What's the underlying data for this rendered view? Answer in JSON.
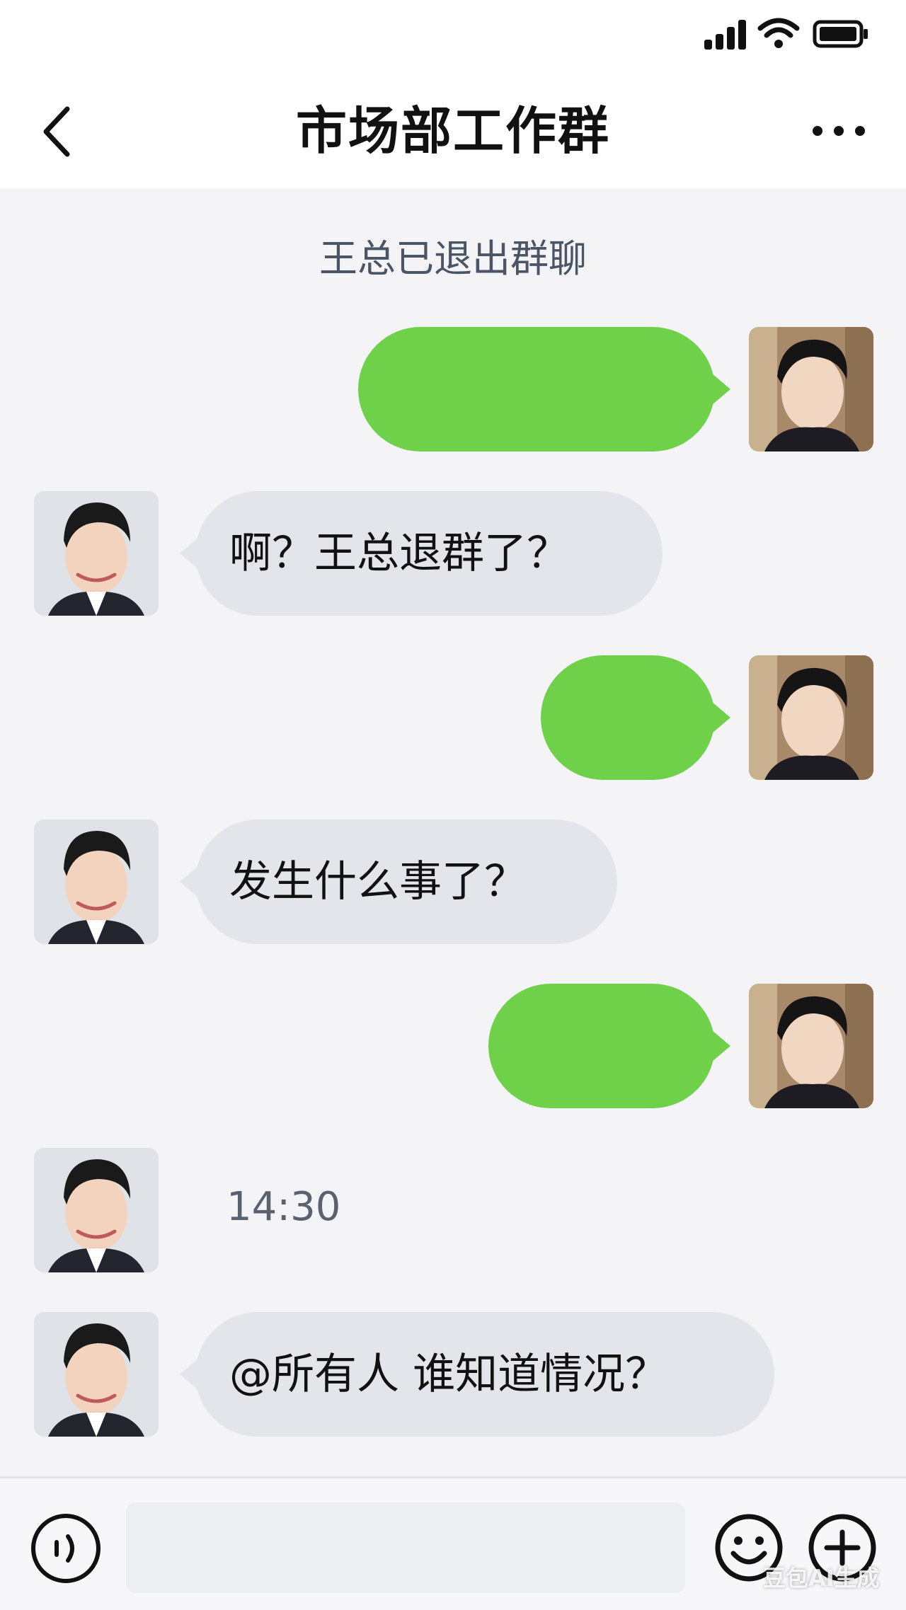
{
  "status_bar": {
    "icons": [
      "signal-icon",
      "wifi-icon",
      "battery-icon"
    ]
  },
  "header": {
    "back_icon": "chevron-left-icon",
    "title": "市场部工作群",
    "more_icon": "ellipsis-icon"
  },
  "chat": {
    "system_message": "王总已退出群聊",
    "messages": [
      {
        "side": "right",
        "text": "",
        "avatar": "avatar-self"
      },
      {
        "side": "left",
        "text": "啊？王总退群了？",
        "avatar": "avatar-colleague"
      },
      {
        "side": "right",
        "text": "",
        "avatar": "avatar-self"
      },
      {
        "side": "left",
        "text": "发生什么事了？",
        "avatar": "avatar-colleague"
      },
      {
        "side": "right",
        "text": "",
        "avatar": "avatar-self"
      },
      {
        "side": "left",
        "text": "",
        "avatar": "avatar-colleague"
      },
      {
        "side": "left",
        "text": "@所有人 谁知道情况？",
        "avatar": "avatar-colleague"
      }
    ],
    "time_label": "14:30"
  },
  "input_bar": {
    "voice_icon": "voice-icon",
    "input_value": "",
    "emoji_icon": "emoji-icon",
    "plus_icon": "plus-icon"
  },
  "watermark": "豆包AI生成",
  "colors": {
    "sent_bubble": "#6fd04a",
    "received_bubble": "#e4e5ea",
    "background": "#f4f4f6"
  }
}
